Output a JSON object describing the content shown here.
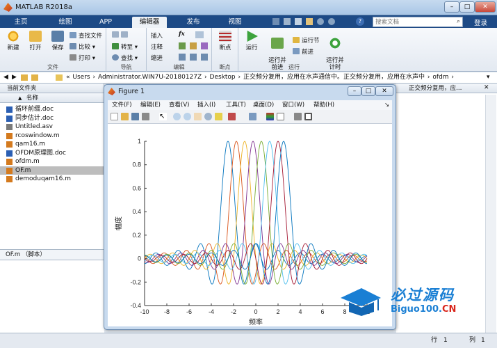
{
  "app": {
    "title": "MATLAB R2018a",
    "search_placeholder": "搜索文档",
    "login": "登录"
  },
  "tabs": [
    {
      "label": "主页"
    },
    {
      "label": "绘图"
    },
    {
      "label": "APP"
    },
    {
      "label": "编辑器"
    },
    {
      "label": "发布"
    },
    {
      "label": "视图"
    }
  ],
  "ribbon": {
    "file": {
      "new": "新建",
      "open": "打开",
      "save": "保存",
      "find_files": "查找文件",
      "compare": "比较",
      "print": "打印",
      "group": "文件"
    },
    "nav": {
      "goto": "转至",
      "find": "查找",
      "group": "导航"
    },
    "edit": {
      "insert": "插入",
      "fx": "fx",
      "comment": "注释",
      "indent": "缩进",
      "group": "编辑"
    },
    "breakpoint": {
      "label": "断点",
      "group": "断点"
    },
    "run": {
      "run": "运行",
      "run_adv": "运行并\n前进",
      "run_section": "运行节",
      "advance": "前进",
      "run_time": "运行并\n计时",
      "group": "运行"
    }
  },
  "path": {
    "segments": [
      "«",
      "Users",
      "›",
      "Administrator.WIN7U-20180127Z",
      "›",
      "Desktop",
      "›",
      "正交频分复用，应用在水声通信中。正交频分复用，应用在水声中",
      "›",
      "ofdm",
      "›"
    ]
  },
  "left": {
    "header": "当前文件夹",
    "col": "名称",
    "sort": "▲",
    "files": [
      {
        "name": "循环前缀.doc",
        "type": "doc"
      },
      {
        "name": "同步估计.doc",
        "type": "doc"
      },
      {
        "name": "Untitled.asv",
        "type": "asv"
      },
      {
        "name": "rcoswindow.m",
        "type": "m"
      },
      {
        "name": "qam16.m",
        "type": "m"
      },
      {
        "name": "OFDM原理图.doc",
        "type": "doc"
      },
      {
        "name": "ofdm.m",
        "type": "m"
      },
      {
        "name": "OF.m",
        "type": "m",
        "selected": true
      },
      {
        "name": "demoduqam16.m",
        "type": "m"
      }
    ],
    "detail": "OF.m （脚本）"
  },
  "right": {
    "path_tail": "正交频分复用，应…"
  },
  "status": {
    "row_label": "行",
    "row": "1",
    "col_label": "列",
    "col": "1"
  },
  "figure": {
    "title": "Figure 1",
    "menu": [
      "文件(F)",
      "编辑(E)",
      "查看(V)",
      "插入(I)",
      "工具(T)",
      "桌面(D)",
      "窗口(W)",
      "帮助(H)"
    ],
    "dock": "↘"
  },
  "watermark": {
    "text": "必过源码",
    "sub_a": "Biguo100.",
    "sub_b": "CN"
  },
  "chart_data": {
    "type": "line",
    "xlabel": "频率",
    "ylabel": "幅度",
    "xlim": [
      -10,
      10
    ],
    "ylim": [
      -0.4,
      1
    ],
    "xticks": [
      -10,
      -8,
      -6,
      -4,
      -2,
      0,
      2,
      4,
      6,
      8,
      10
    ],
    "yticks": [
      -0.4,
      -0.2,
      0,
      0.2,
      0.4,
      0.6,
      0.8,
      1
    ],
    "function": "sinc(x - shift)",
    "series": [
      {
        "shift": -2.5,
        "color": "#0072bd"
      },
      {
        "shift": -1.75,
        "color": "#d95319"
      },
      {
        "shift": -1.0,
        "color": "#edb120"
      },
      {
        "shift": -0.25,
        "color": "#7e2f8e"
      },
      {
        "shift": 0.5,
        "color": "#77ac30"
      },
      {
        "shift": 1.25,
        "color": "#4dbeee"
      },
      {
        "shift": 2.0,
        "color": "#a2142f"
      },
      {
        "shift": 2.5,
        "color": "#0072bd"
      }
    ],
    "grid": false
  }
}
